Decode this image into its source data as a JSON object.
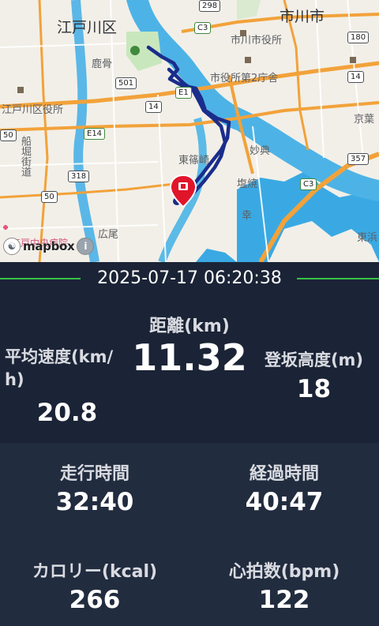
{
  "map": {
    "labels": {
      "edogawa_ku": "江戸川区",
      "ichikawa_shi": "市川市",
      "kasai": "鹿骨",
      "ichikawa_office": "市川市役所",
      "city_office_2": "市役所第2庁舎",
      "edogawa_office": "江戸川区役所",
      "funabori_kaido": "船堀街道",
      "higashi_shinozaki": "東篠崎",
      "myoten": "妙典",
      "shiohama": "塩焼",
      "sachi": "幸",
      "hiroo": "広尾",
      "keiyo": "京葉",
      "higashihama": "東浜",
      "central_hospital": "江戸中央病院"
    },
    "shields": {
      "r298": "298",
      "c3_top": "C3",
      "r180": "180",
      "r501": "501",
      "e1": "E1",
      "r14_a": "14",
      "r14_b": "14",
      "e14": "E14",
      "r50_a": "50",
      "r318": "318",
      "r357": "357",
      "c3_mid": "C3",
      "r50_b": "50"
    },
    "attribution": "mapbox",
    "info_icon": "i"
  },
  "stats": {
    "datetime": "2025-07-17 06:20:38",
    "distance_label": "距離(km)",
    "distance_value": "11.32",
    "avg_speed_label_line1": "平均速度(km/",
    "avg_speed_label_line2": "h)",
    "avg_speed_value": "20.8",
    "climb_label": "登坂高度(m)",
    "climb_value": "18",
    "moving_time_label": "走行時間",
    "moving_time_value": "32:40",
    "elapsed_time_label": "経過時間",
    "elapsed_time_value": "40:47",
    "calories_label": "カロリー(kcal)",
    "calories_value": "266",
    "heart_rate_label": "心拍数(bpm)",
    "heart_rate_value": "122"
  },
  "colors": {
    "route": "#1a2d8c",
    "pin": "#e0152a",
    "river": "#4db3e6",
    "sea": "#3aa9e3",
    "accent_line": "#37c147",
    "panel": "#1b2436"
  }
}
